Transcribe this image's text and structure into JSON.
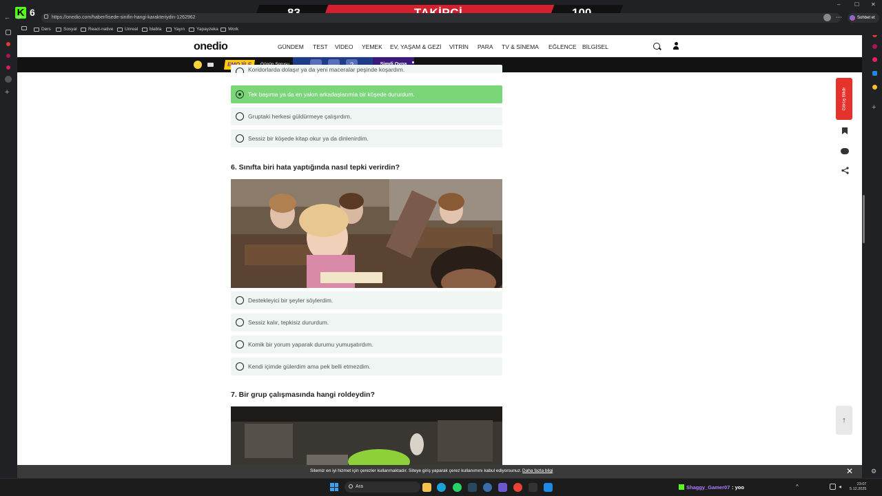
{
  "browser": {
    "url": "https://onedio.com/haber/lisede-sinifin-hangi-karakteriydin-1262962",
    "bookmarks": [
      "Ders",
      "Sosyal",
      "React-native",
      "Unreal",
      "blabla",
      "Yayın",
      "Yapayzeka",
      "Work"
    ],
    "chat_button": "Sohbet et"
  },
  "stream_overlay": {
    "current": "83",
    "label": "TAKİPÇİ",
    "goal": "100",
    "kick_count": "6"
  },
  "site": {
    "logo": "onedio",
    "nav": [
      "GÜNDEM",
      "TEST",
      "VİDEO",
      "YEMEK",
      "EV, YAŞAM & GEZİ",
      "VİTRİN",
      "PARA",
      "TV & SİNEMA",
      "EĞLENCE",
      "BİLGİSEL"
    ],
    "strip": {
      "game_logo": "EMOJİLE",
      "daily_question": "Günün Sorusu",
      "question_mark": "?",
      "play_now": "Şimdi Oyna"
    },
    "feedback": "Görüş Bildir"
  },
  "quiz": {
    "prev_options": [
      {
        "text": "Koridorlarda dolaşır ya da yeni maceralar peşinde koşardım.",
        "selected": false
      },
      {
        "text": "Tek başıma ya da en yakın arkadaşlarımla bir köşede dururdum.",
        "selected": true
      },
      {
        "text": "Gruptaki herkesi güldürmeye çalışırdım.",
        "selected": false
      },
      {
        "text": "Sessiz bir köşede kitap okur ya da dinlenirdim.",
        "selected": false
      }
    ],
    "q6": {
      "title": "6. Sınıfta biri hata yaptığında nasıl tepki verirdin?",
      "options": [
        "Destekleyici bir şeyler söylerdim.",
        "Sessiz kalır, tepkisiz dururdum.",
        "Komik bir yorum yaparak durumu yumuşatırdım.",
        "Kendi içimde gülerdim ama pek belli etmezdim."
      ]
    },
    "q7": {
      "title": "7. Bir grup çalışmasında hangi roldeydin?"
    }
  },
  "cookie": {
    "text": "Sitemiz en iyi hizmet için çerezler kullanmaktadır. Siteye giriş yaparak çerez kullanımını kabul ediyorsunuz.",
    "link": "Daha fazla bilgi"
  },
  "taskbar": {
    "search": "Ara",
    "chat_user": "Shaggy_Gamer07",
    "chat_msg": ": yoo",
    "time": "23:07",
    "date": "5.12.2025"
  }
}
